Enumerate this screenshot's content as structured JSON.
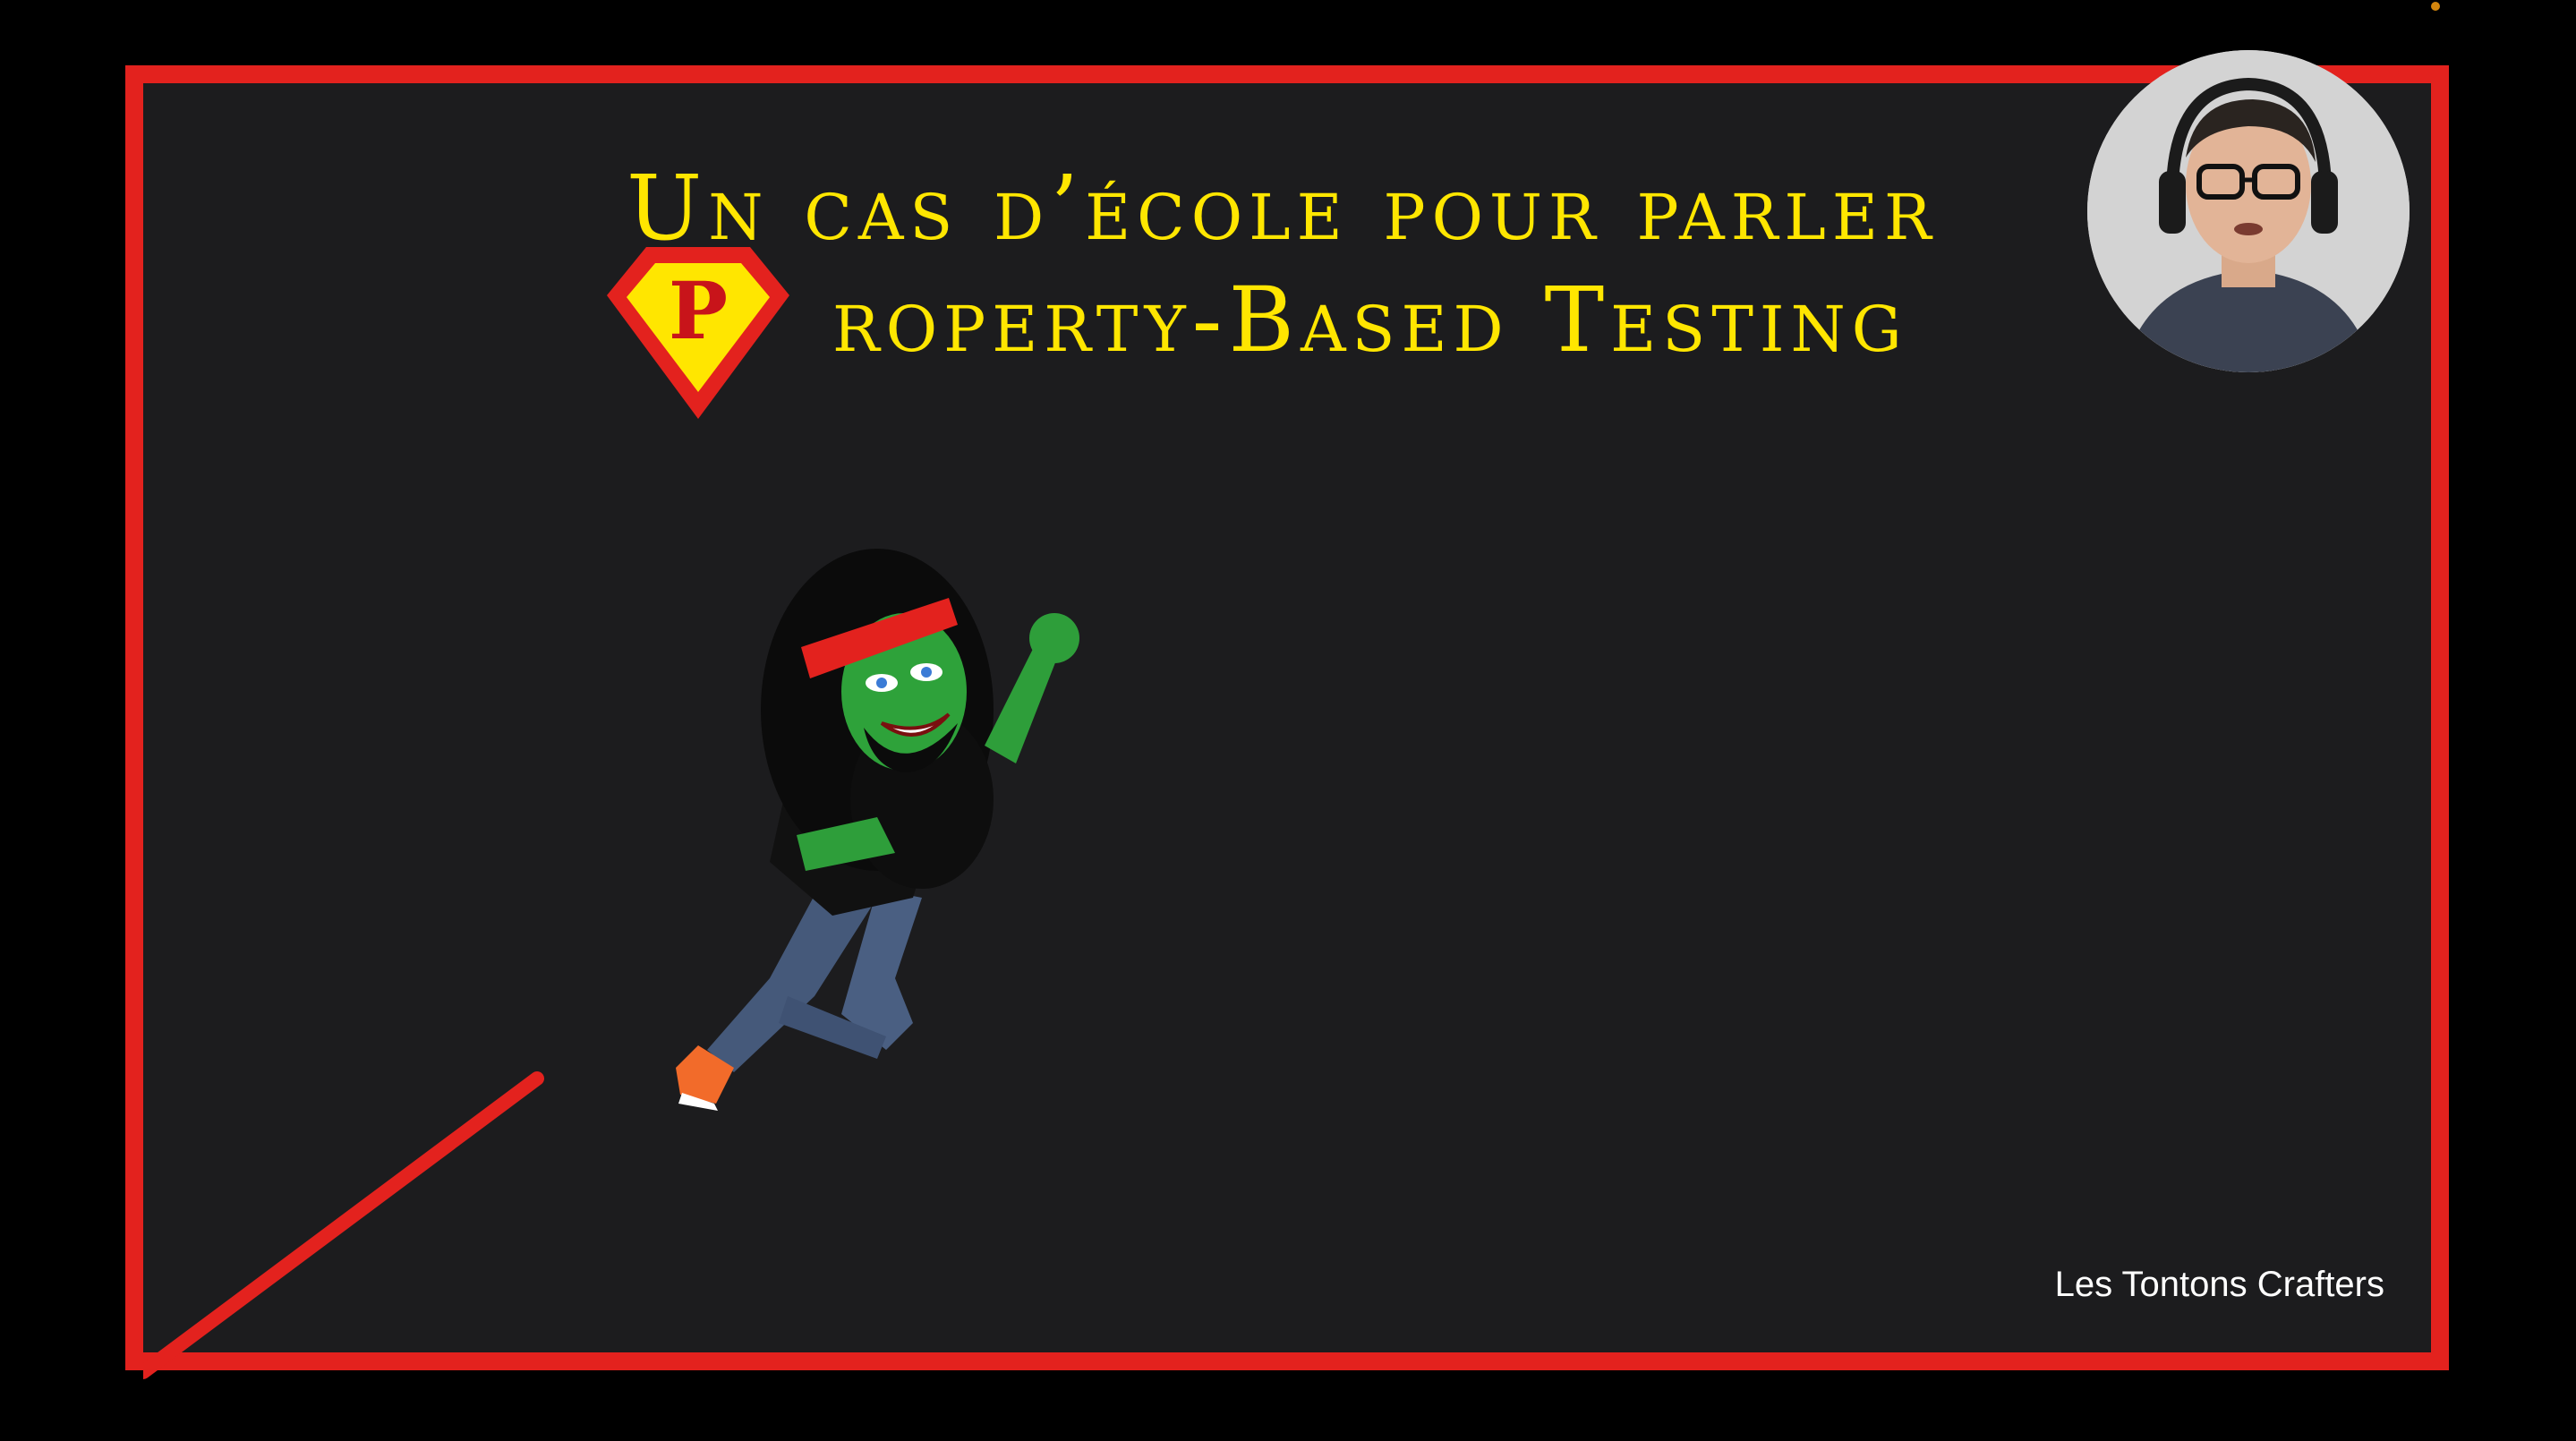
{
  "slide": {
    "title_line_1": "Un cas d’école pour parler",
    "badge_letter": "P",
    "title_line_2": "roperty-Based Testing",
    "credit": "Les Tontons Crafters"
  },
  "colors": {
    "frame_red": "#e3221e",
    "title_yellow": "#ffe600",
    "slide_background": "#1c1c1e"
  },
  "icons": {
    "badge": "superhero-shield-icon",
    "illustration": "flying-superhero-avatar",
    "webcam": "presenter-webcam-overlay"
  }
}
